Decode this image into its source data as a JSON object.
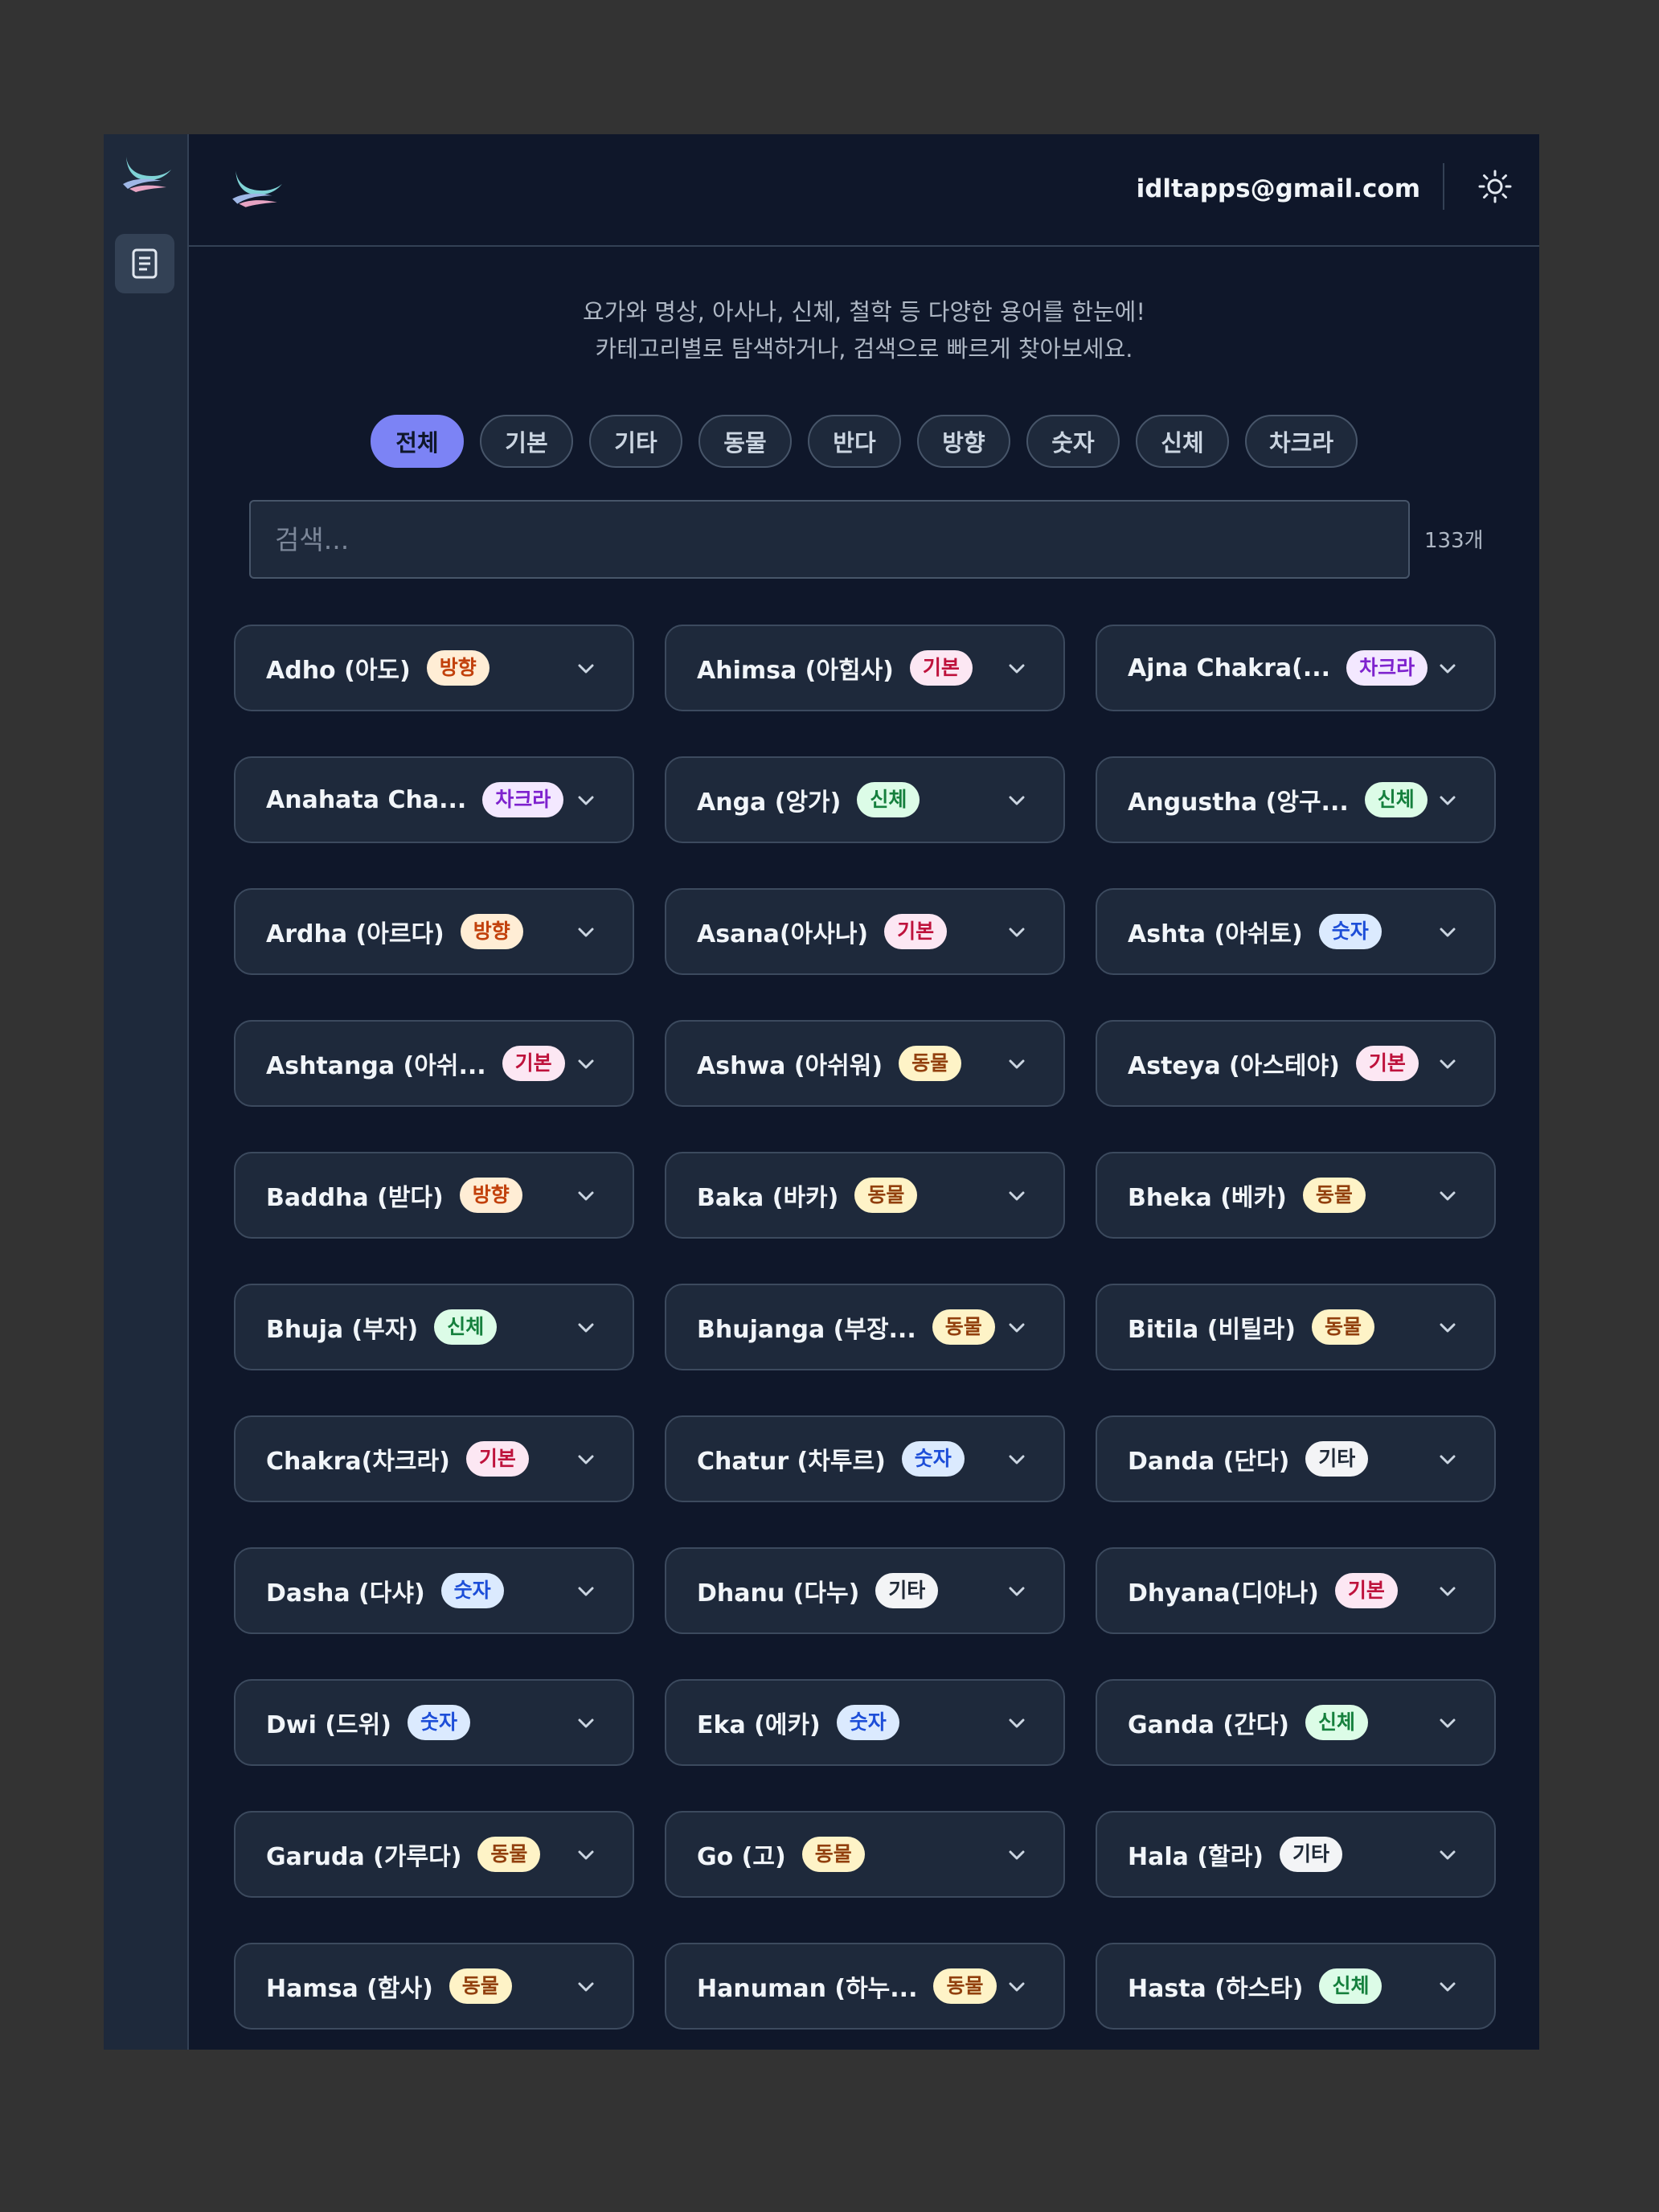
{
  "header": {
    "email": "idltapps@gmail.com"
  },
  "intro": {
    "line1": "요가와 명상, 아사나, 신체, 철학 등 다양한 용어를 한눈에!",
    "line2": "카테고리별로 탐색하거나, 검색으로 빠르게 찾아보세요."
  },
  "filters": [
    "전체",
    "기본",
    "기타",
    "동물",
    "반다",
    "방향",
    "숫자",
    "신체",
    "차크라"
  ],
  "active_filter": "전체",
  "search": {
    "placeholder": "검색...",
    "value": "",
    "count": "133개"
  },
  "category_colors": {
    "방향": {
      "bg": "#ffedd5",
      "fg": "#c2410c"
    },
    "기본": {
      "bg": "#fce7f3",
      "fg": "#be123c"
    },
    "차크라": {
      "bg": "#f3e8ff",
      "fg": "#7e22ce"
    },
    "신체": {
      "bg": "#dcfce7",
      "fg": "#15803d"
    },
    "숫자": {
      "bg": "#dbeafe",
      "fg": "#1d4ed8"
    },
    "동물": {
      "bg": "#fef3c7",
      "fg": "#92400e"
    },
    "기타": {
      "bg": "#f3f4f6",
      "fg": "#1f2937"
    }
  },
  "terms": [
    {
      "title": "Adho (아도)",
      "category": "방향"
    },
    {
      "title": "Ahimsa (아힘사)",
      "category": "기본"
    },
    {
      "title": "Ajna Chakra(...",
      "category": "차크라"
    },
    {
      "title": "Anahata Cha...",
      "category": "차크라"
    },
    {
      "title": "Anga (앙가)",
      "category": "신체"
    },
    {
      "title": "Angustha (앙구...",
      "category": "신체"
    },
    {
      "title": "Ardha (아르다)",
      "category": "방향"
    },
    {
      "title": "Asana(아사나)",
      "category": "기본"
    },
    {
      "title": "Ashta (아쉬토)",
      "category": "숫자"
    },
    {
      "title": "Ashtanga (아쉬...",
      "category": "기본"
    },
    {
      "title": "Ashwa (아쉬워)",
      "category": "동물"
    },
    {
      "title": "Asteya (아스테야)",
      "category": "기본"
    },
    {
      "title": "Baddha (받다)",
      "category": "방향"
    },
    {
      "title": "Baka (바카)",
      "category": "동물"
    },
    {
      "title": "Bheka (베카)",
      "category": "동물"
    },
    {
      "title": "Bhuja (부자)",
      "category": "신체"
    },
    {
      "title": "Bhujanga (부장...",
      "category": "동물"
    },
    {
      "title": "Bitila (비틸라)",
      "category": "동물"
    },
    {
      "title": "Chakra(차크라)",
      "category": "기본"
    },
    {
      "title": "Chatur (차투르)",
      "category": "숫자"
    },
    {
      "title": "Danda (단다)",
      "category": "기타"
    },
    {
      "title": "Dasha (다샤)",
      "category": "숫자"
    },
    {
      "title": "Dhanu (다누)",
      "category": "기타"
    },
    {
      "title": "Dhyana(디야나)",
      "category": "기본"
    },
    {
      "title": "Dwi (드위)",
      "category": "숫자"
    },
    {
      "title": "Eka (에카)",
      "category": "숫자"
    },
    {
      "title": "Ganda (간다)",
      "category": "신체"
    },
    {
      "title": "Garuda (가루다)",
      "category": "동물"
    },
    {
      "title": "Go (고)",
      "category": "동물"
    },
    {
      "title": "Hala (할라)",
      "category": "기타"
    },
    {
      "title": "Hamsa (함사)",
      "category": "동물"
    },
    {
      "title": "Hanuman (하누...",
      "category": "동물"
    },
    {
      "title": "Hasta (하스타)",
      "category": "신체"
    }
  ]
}
